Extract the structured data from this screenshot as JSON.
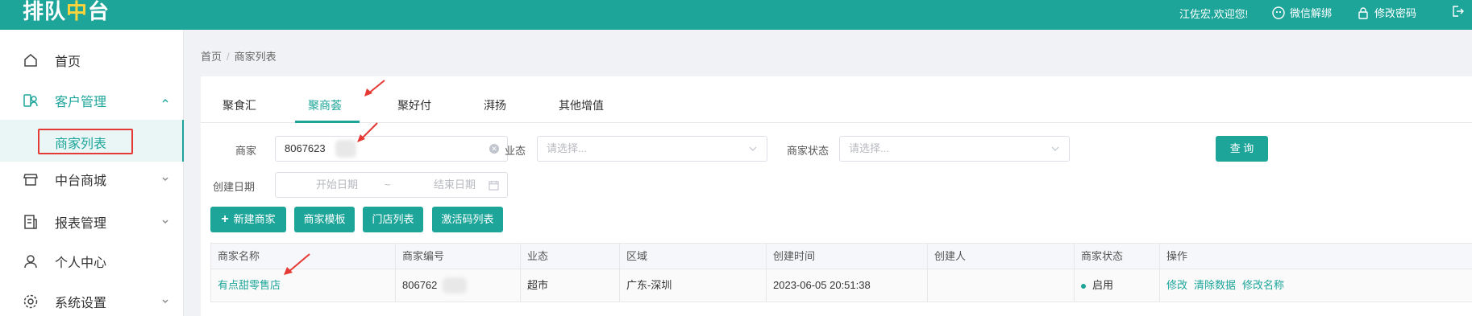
{
  "header": {
    "logo_main": "排队",
    "logo_accent": "中",
    "logo_tail": "台",
    "welcome": "江佐宏,欢迎您!",
    "wechat_unbind": "微信解绑",
    "change_password": "修改密码",
    "color": "#1da59a"
  },
  "sidebar": {
    "items": [
      {
        "label": "首页",
        "icon": "home-icon"
      },
      {
        "label": "客户管理",
        "icon": "customer-icon"
      },
      {
        "label": "中台商城",
        "icon": "store-icon"
      },
      {
        "label": "报表管理",
        "icon": "report-icon"
      },
      {
        "label": "个人中心",
        "icon": "user-icon"
      },
      {
        "label": "系统设置",
        "icon": "gear-icon"
      }
    ],
    "sub_item": "商家列表"
  },
  "breadcrumb": {
    "home": "首页",
    "sep": "/",
    "current": "商家列表"
  },
  "tabs": [
    "聚食汇",
    "聚商荟",
    "聚好付",
    "湃扬",
    "其他增值"
  ],
  "active_tab": "聚商荟",
  "filters": {
    "merchant_label": "商家",
    "merchant_value": "8067623",
    "industry_label": "业态",
    "industry_placeholder": "请选择...",
    "status_label": "商家状态",
    "status_placeholder": "请选择...",
    "query_button": "查 询",
    "date_label": "创建日期",
    "start_placeholder": "开始日期",
    "date_sep": "~",
    "end_placeholder": "结束日期"
  },
  "actions": {
    "new_merchant": "新建商家",
    "merchant_template": "商家模板",
    "store_list": "门店列表",
    "activation_codes": "激活码列表"
  },
  "table": {
    "columns": [
      "商家名称",
      "商家编号",
      "业态",
      "区域",
      "创建时间",
      "创建人",
      "商家状态",
      "操作"
    ],
    "rows": [
      {
        "name": "有点甜零售店",
        "code": "806762",
        "industry": "超市",
        "region": "广东-深圳",
        "created_at": "2023-06-05 20:51:38",
        "creator": "",
        "status": "启用",
        "ops": [
          "修改",
          "清除数据",
          "修改名称"
        ]
      }
    ]
  }
}
